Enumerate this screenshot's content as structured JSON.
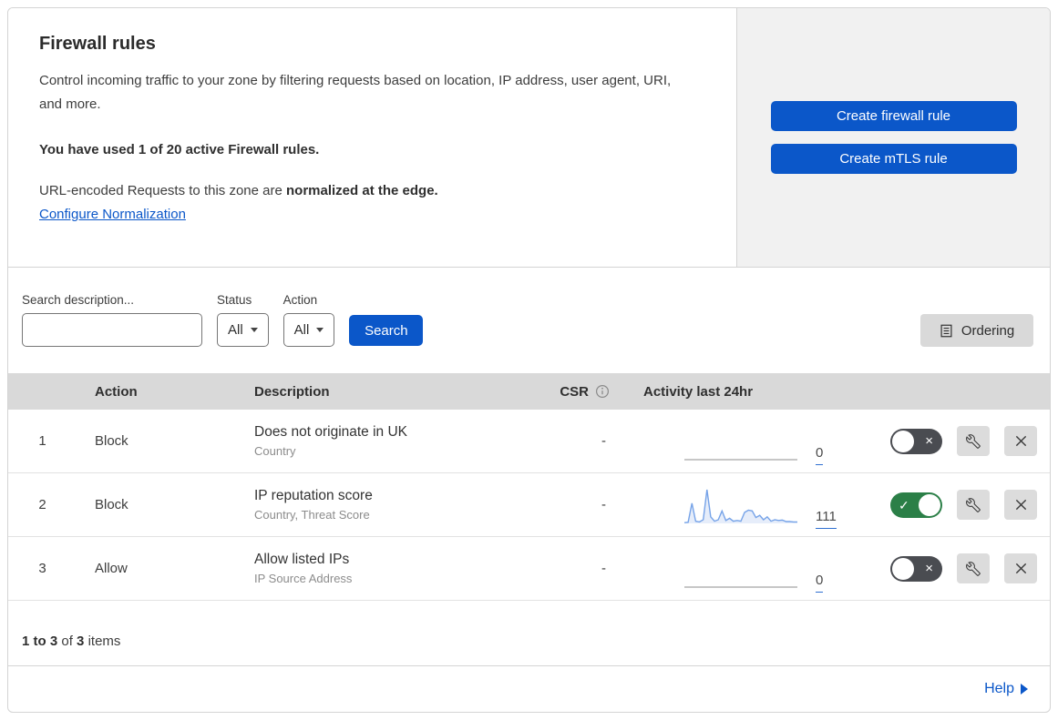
{
  "header": {
    "title": "Firewall rules",
    "description": "Control incoming traffic to your zone by filtering requests based on location, IP address, user agent, URI, and more.",
    "usage_bold": "You have used 1 of 20 active Firewall rules.",
    "normalization_prefix": "URL-encoded Requests to this zone are ",
    "normalization_bold": "normalized at the edge.",
    "normalization_link": "Configure Normalization"
  },
  "actions": {
    "create_firewall_rule": "Create firewall rule",
    "create_mtls_rule": "Create mTLS rule"
  },
  "filters": {
    "search_label": "Search description...",
    "search_value": "",
    "status_label": "Status",
    "status_value": "All",
    "action_label": "Action",
    "action_value": "All",
    "search_button": "Search",
    "ordering_button": "Ordering"
  },
  "table": {
    "columns": {
      "action": "Action",
      "description": "Description",
      "csr": "CSR",
      "activity": "Activity last 24hr"
    },
    "rows": [
      {
        "priority": "1",
        "action": "Block",
        "description": "Does not originate in UK",
        "criteria": "Country",
        "csr": "-",
        "activity_count": "0",
        "enabled": false,
        "sparkline": []
      },
      {
        "priority": "2",
        "action": "Block",
        "description": "IP reputation score",
        "criteria": "Country, Threat Score",
        "csr": "-",
        "activity_count": "111",
        "enabled": true,
        "sparkline": [
          2,
          3,
          55,
          6,
          4,
          10,
          92,
          18,
          6,
          10,
          34,
          8,
          14,
          6,
          8,
          6,
          30,
          36,
          34,
          16,
          22,
          10,
          18,
          6,
          10,
          8,
          9,
          5,
          5,
          4,
          4
        ]
      },
      {
        "priority": "3",
        "action": "Allow",
        "description": "Allow listed IPs",
        "criteria": "IP Source Address",
        "csr": "-",
        "activity_count": "0",
        "enabled": false,
        "sparkline": []
      }
    ]
  },
  "summary": {
    "range": "1 to 3",
    "of": "of",
    "total": "3",
    "items": "items"
  },
  "footer": {
    "help": "Help"
  },
  "colors": {
    "primary_blue": "#0b57c9",
    "link_blue": "#0b57c9",
    "toggle_on_green": "#2b7f47",
    "toggle_off_gray": "#4a4c51",
    "panel_gray": "#f1f1f1",
    "table_header_gray": "#d9d9d9",
    "sparkline_blue": "#76a3e8",
    "count_underline_blue": "#2f6fd1"
  }
}
